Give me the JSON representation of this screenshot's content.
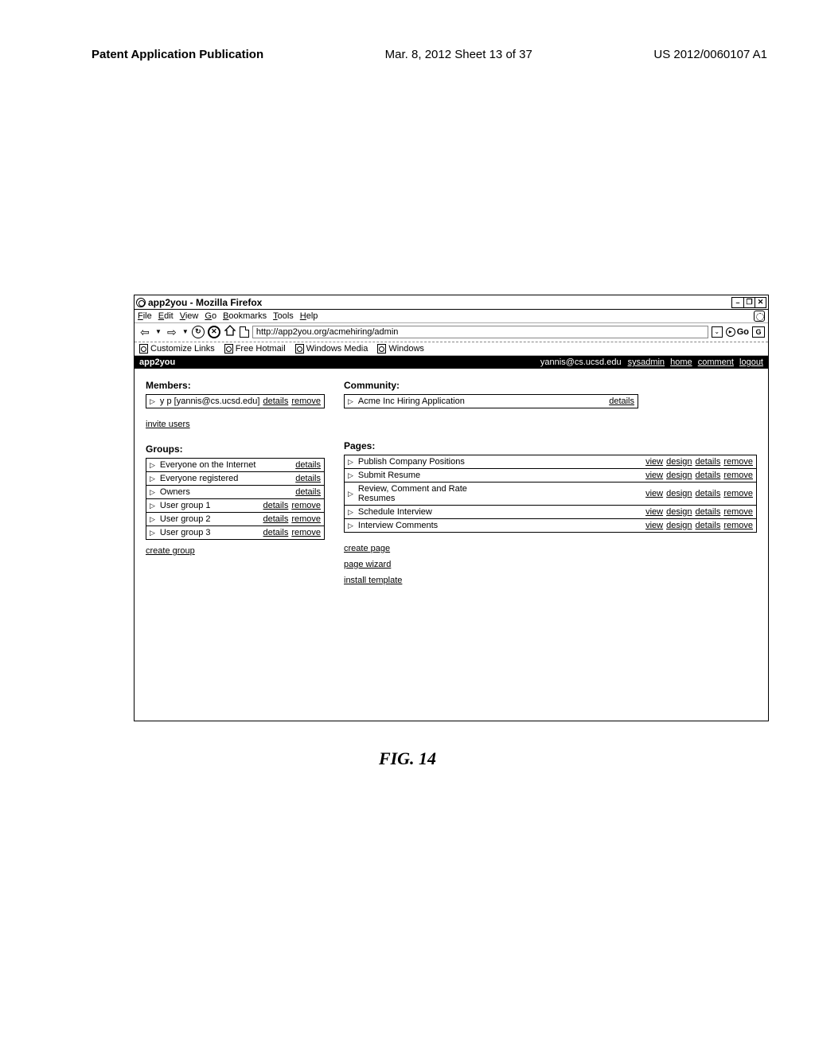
{
  "doc_header": {
    "left": "Patent Application Publication",
    "center": "Mar. 8, 2012  Sheet 13 of 37",
    "right": "US 2012/0060107 A1"
  },
  "titlebar": {
    "title": "app2you - Mozilla Firefox"
  },
  "menubar": {
    "items": [
      "File",
      "Edit",
      "View",
      "Go",
      "Bookmarks",
      "Tools",
      "Help"
    ]
  },
  "nav": {
    "url": "http://app2you.org/acmehiring/admin",
    "go_label": "Go",
    "search_letter": "G"
  },
  "bookmarks": {
    "items": [
      "Customize Links",
      "Free Hotmail",
      "Windows Media",
      "Windows"
    ]
  },
  "appbar": {
    "title": "app2you",
    "user_email": "yannis@cs.ucsd.edu",
    "links": [
      "sysadmin",
      "home",
      "comment",
      "logout"
    ]
  },
  "left_col": {
    "members_title": "Members:",
    "members": [
      {
        "label": "y p [yannis@cs.ucsd.edu]",
        "actions": [
          "details",
          "remove"
        ]
      }
    ],
    "invite_link": "invite users",
    "groups_title": "Groups:",
    "groups": [
      {
        "label": "Everyone on the Internet",
        "actions": [
          "details"
        ]
      },
      {
        "label": "Everyone registered",
        "actions": [
          "details"
        ]
      },
      {
        "label": "Owners",
        "actions": [
          "details"
        ]
      },
      {
        "label": "User group 1",
        "actions": [
          "details",
          "remove"
        ]
      },
      {
        "label": "User group 2",
        "actions": [
          "details",
          "remove"
        ]
      },
      {
        "label": "User group 3",
        "actions": [
          "details",
          "remove"
        ]
      }
    ],
    "create_group_link": "create group"
  },
  "right_col": {
    "community_title": "Community:",
    "community": [
      {
        "label": "Acme Inc Hiring Application",
        "actions": [
          "details"
        ]
      }
    ],
    "pages_title": "Pages:",
    "pages": [
      {
        "label": "Publish Company Positions",
        "actions": [
          "view",
          "design",
          "details",
          "remove"
        ]
      },
      {
        "label": "Submit Resume",
        "actions": [
          "view",
          "design",
          "details",
          "remove"
        ]
      },
      {
        "label": "Review, Comment and Rate Resumes",
        "actions": [
          "view",
          "design",
          "details",
          "remove"
        ]
      },
      {
        "label": "Schedule Interview",
        "actions": [
          "view",
          "design",
          "details",
          "remove"
        ]
      },
      {
        "label": "Interview Comments",
        "actions": [
          "view",
          "design",
          "details",
          "remove"
        ]
      }
    ],
    "create_page_link": "create page",
    "page_wizard_link": "page wizard",
    "install_template_link": "install template"
  },
  "figure_caption": "FIG. 14",
  "labels": {
    "details": "details",
    "remove": "remove",
    "view": "view",
    "design": "design"
  }
}
